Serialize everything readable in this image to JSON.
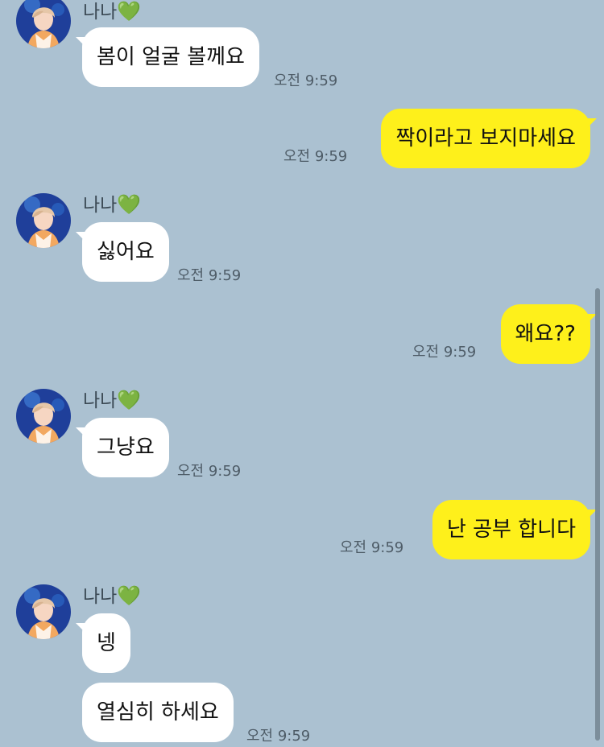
{
  "chat": {
    "messages": [
      {
        "sender": "나나",
        "heart": "💚",
        "text": "봄이 얼굴 볼께요",
        "time": "오전 9:59"
      },
      {
        "text": "짝이라고 보지마세요",
        "time": "오전 9:59"
      },
      {
        "sender": "나나",
        "heart": "💚",
        "text": "싫어요",
        "time": "오전 9:59"
      },
      {
        "text": "왜요??",
        "time": "오전 9:59"
      },
      {
        "sender": "나나",
        "heart": "💚",
        "text": "그냥요",
        "time": "오전 9:59"
      },
      {
        "text": "난 공부 합니다",
        "time": "오전 9:59"
      },
      {
        "sender": "나나",
        "heart": "💚",
        "text": "넹"
      },
      {
        "text": "열심히 하세요",
        "time": "오전 9:59"
      }
    ]
  },
  "colors": {
    "background": "#abc1d1",
    "incoming_bubble": "#ffffff",
    "outgoing_bubble": "#fef01b"
  }
}
